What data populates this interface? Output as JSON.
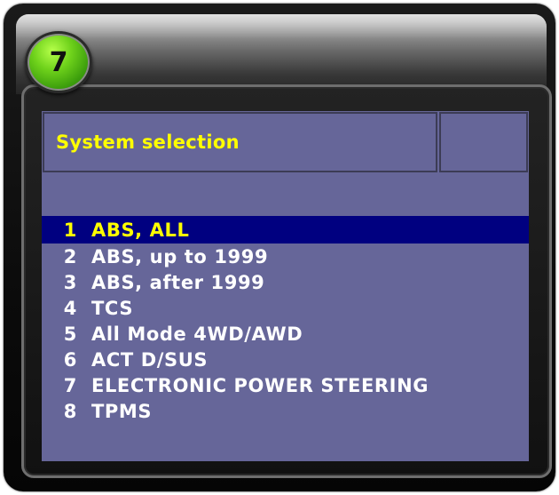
{
  "step_badge": "7",
  "screen": {
    "title": "System selection",
    "items": [
      {
        "num": "1",
        "label": "ABS, ALL",
        "selected": true
      },
      {
        "num": "2",
        "label": "ABS, up to 1999"
      },
      {
        "num": "3",
        "label": "ABS, after 1999"
      },
      {
        "num": "4",
        "label": "TCS"
      },
      {
        "num": "5",
        "label": "All Mode 4WD/AWD"
      },
      {
        "num": "6",
        "label": "ACT D/SUS"
      },
      {
        "num": "7",
        "label": "ELECTRONIC POWER STEERING"
      },
      {
        "num": "8",
        "label": "TPMS"
      }
    ]
  },
  "colors": {
    "screen_bg": "#666699",
    "selected_bg": "#000080",
    "selected_text": "#ffff00",
    "title_text": "#ffff00",
    "item_text": "#ffffff",
    "badge": "#6fd21b"
  }
}
